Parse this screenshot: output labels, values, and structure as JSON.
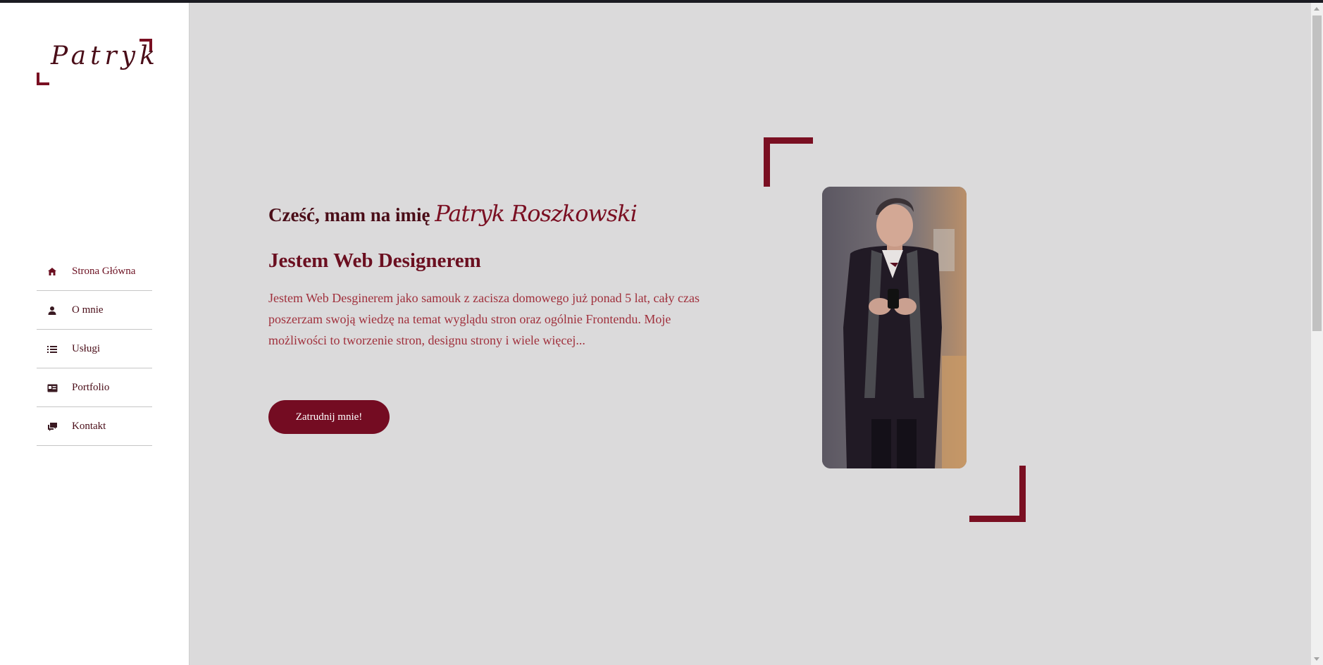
{
  "sidebar": {
    "logo": "Patryk",
    "items": [
      {
        "label": "Strona Główna",
        "icon": "home-icon"
      },
      {
        "label": "O mnie",
        "icon": "user-icon"
      },
      {
        "label": "Usługi",
        "icon": "list-icon"
      },
      {
        "label": "Portfolio",
        "icon": "portfolio-icon"
      },
      {
        "label": "Kontakt",
        "icon": "chat-icon"
      }
    ]
  },
  "hero": {
    "greeting": "Cześć, mam na imię",
    "name": "Patryk Roszkowski",
    "role": "Jestem Web Designerem",
    "description": "Jestem Web Desginerem jako samouk z zacisza domowego już ponad 5 lat, cały czas poszerzam swoją wiedzę na temat wyglądu stron oraz ogólnie Frontendu. Moje możliwości to tworzenie stron, designu strony i wiele więcej...",
    "cta_label": "Zatrudnij mnie!"
  },
  "colors": {
    "accent": "#7a0f22",
    "background": "#dbdadb",
    "text_dark": "#4a0d18",
    "text_desc": "#a0303c"
  }
}
